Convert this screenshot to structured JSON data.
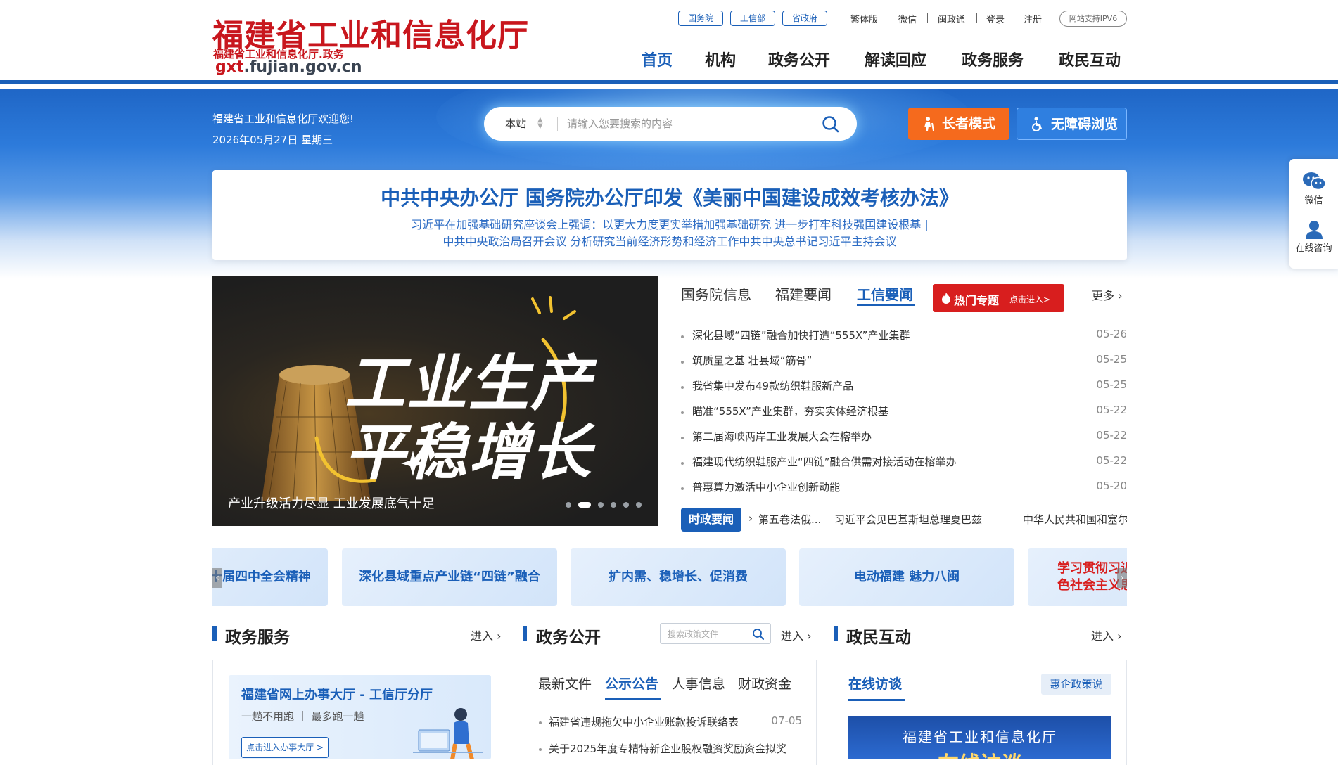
{
  "header": {
    "logo_title": "福建省工业和信息化厅",
    "logo_sub": "福建省工业和信息化厅.政务",
    "logo_domain_prefix": "gxt",
    "logo_domain_suffix": ".fujian.gov.cn",
    "org_links": [
      "国务院",
      "工信部",
      "省政府"
    ],
    "top_links": [
      "繁体版",
      "微信",
      "闽政通",
      "登录",
      "注册"
    ],
    "ipv6_label": "网站支持IPV6",
    "nav": [
      "首页",
      "机构",
      "政务公开",
      "解读回应",
      "政务服务",
      "政民互动"
    ],
    "nav_active_index": 0
  },
  "banner": {
    "welcome": "福建省工业和信息化厅欢迎您!",
    "date": "2026年05月27日 星期三",
    "search": {
      "scope": "本站",
      "placeholder": "请输入您要搜索的内容"
    },
    "elder_mode_label": "长者模式",
    "accessible_label": "无障碍浏览"
  },
  "headline": {
    "title": "中共中央办公厅 国务院办公厅印发《美丽中国建设成效考核办法》",
    "sub1": "习近平在加强基础研究座谈会上强调：以更大力度更实举措加强基础研究 进一步打牢科技强国建设根基 |",
    "sub2": "中共中央政治局召开会议 分析研究当前经济形势和经济工作中共中央总书记习近平主持会议"
  },
  "side_float": {
    "wechat_label": "微信",
    "consult_label": "在线咨询"
  },
  "carousel": {
    "line1": "工业生产",
    "line2": "平稳增长",
    "caption": "产业升级活力尽显 工业发展底气十足",
    "dot_count": 6,
    "active_dot": 1
  },
  "news": {
    "tabs": [
      "国务院信息",
      "福建要闻",
      "工信要闻"
    ],
    "active_tab": 2,
    "hot_topic_label": "热门专题",
    "hot_topic_enter": "点击进入>",
    "more_label": "更多",
    "items": [
      {
        "title": "深化县域“四链”融合加快打造“555X”产业集群",
        "date": "05-26"
      },
      {
        "title": "筑质量之基 壮县域“筋骨”",
        "date": "05-25"
      },
      {
        "title": "我省集中发布49款纺织鞋服新产品",
        "date": "05-25"
      },
      {
        "title": "瞄准“555X”产业集群，夯实实体经济根基",
        "date": "05-22"
      },
      {
        "title": "第二届海峡两岸工业发展大会在榕举办",
        "date": "05-22"
      },
      {
        "title": "福建现代纺织鞋服产业“四链”融合供需对接活动在榕举办",
        "date": "05-22"
      },
      {
        "title": "普惠算力激活中小企业创新动能",
        "date": "05-20"
      }
    ],
    "ticker_tag": "时政要闻",
    "ticker": [
      "第五卷法俄...",
      "习近平会见巴基斯坦总理夏巴兹",
      "中华人民共和国和塞尔"
    ]
  },
  "topics": [
    {
      "label": "二十届四中全会精神",
      "red": false
    },
    {
      "label": "深化县域重点产业链“四链”融合",
      "red": false
    },
    {
      "label": "扩内需、稳增长、促消费",
      "red": false
    },
    {
      "label": "电动福建 魅力八闽",
      "red": false
    },
    {
      "label": "学习贯彻习近平新时代中国特色社会主义思想",
      "red": true
    }
  ],
  "sections": {
    "service": {
      "title": "政务服务",
      "enter": "进入",
      "card_title": "福建省网上办事大厅 - 工信厅分厅",
      "card_slogan": "一趟不用跑 ｜ 最多跑一趟",
      "card_button": "点击进入办事大厅 >"
    },
    "public": {
      "title": "政务公开",
      "enter": "进入",
      "search_placeholder": "搜索政策文件",
      "tabs": [
        "最新文件",
        "公示公告",
        "人事信息",
        "财政资金"
      ],
      "active_tab": 1,
      "items": [
        {
          "title": "福建省违规拖欠中小企业账款投诉联络表",
          "date": "07-05"
        },
        {
          "title": "关于2025年度专精特新企业股权融资奖励资金拟奖",
          "date": ""
        }
      ]
    },
    "interact": {
      "title": "政民互动",
      "enter": "进入",
      "tab": "在线访谈",
      "tag": "惠企政策说",
      "banner_line1": "福建省工业和信息化厅",
      "banner_line2": "在线访谈"
    }
  }
}
